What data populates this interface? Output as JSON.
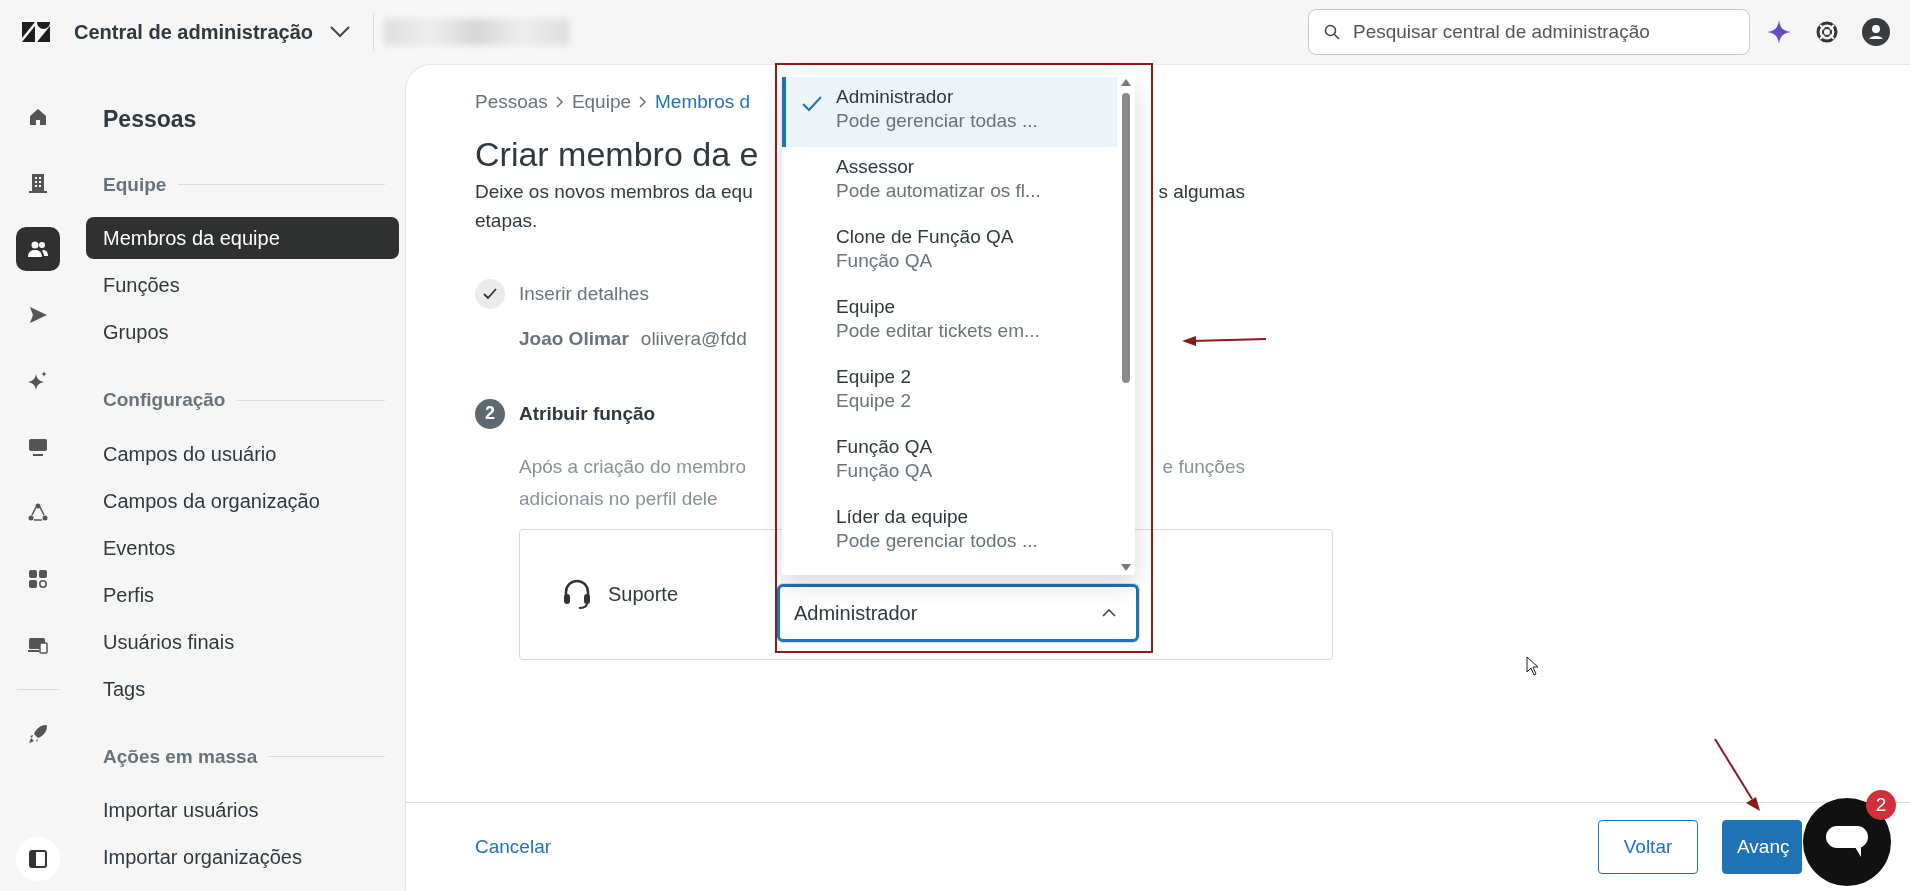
{
  "topbar": {
    "title": "Central de administração",
    "search": {
      "placeholder": "Pesquisar central de administração"
    }
  },
  "rail": [
    {
      "selected": false
    },
    {
      "selected": false
    },
    {
      "selected": true
    },
    {
      "selected": false
    },
    {
      "selected": false
    },
    {
      "selected": false
    },
    {
      "selected": false
    },
    {
      "selected": false
    },
    {
      "selected": false
    },
    {
      "selected": false
    }
  ],
  "sidebar": {
    "title": "Pessoas",
    "sections": [
      {
        "heading": "Equipe",
        "items": [
          {
            "label": "Membros da equipe",
            "selected": true
          },
          {
            "label": "Funções",
            "selected": false
          },
          {
            "label": "Grupos",
            "selected": false
          }
        ]
      },
      {
        "heading": "Configuração",
        "items": [
          {
            "label": "Campos do usuário",
            "selected": false
          },
          {
            "label": "Campos da organização",
            "selected": false
          },
          {
            "label": "Eventos",
            "selected": false
          },
          {
            "label": "Perfis",
            "selected": false
          },
          {
            "label": "Usuários finais",
            "selected": false
          },
          {
            "label": "Tags",
            "selected": false
          }
        ]
      },
      {
        "heading": "Ações em massa",
        "items": [
          {
            "label": "Importar usuários",
            "selected": false
          },
          {
            "label": "Importar organizações",
            "selected": false
          }
        ]
      }
    ]
  },
  "breadcrumb": [
    {
      "label": "Pessoas",
      "current": false
    },
    {
      "label": "Equipe",
      "current": false
    },
    {
      "label": "Membros d",
      "current": true
    }
  ],
  "page": {
    "title": "Criar membro da e",
    "description_left": "Deixe os novos membros da equ",
    "description_right": "s algumas",
    "description_line2": "etapas."
  },
  "steps": [
    {
      "kind": "done",
      "label": "Inserir detalhes",
      "name": "Joao Olimar",
      "email": "oliivera@fdd"
    },
    {
      "kind": "number",
      "number": "2",
      "label": "Atribuir função",
      "note_left": "Após a criação do membro",
      "note_right": "e funções",
      "note_line2": "adicionais no perfil dele"
    }
  ],
  "product": {
    "label": "Suporte",
    "select_value": "Administrador",
    "expanded": true
  },
  "dropdown": {
    "options": [
      {
        "label": "Administrador",
        "description": "Pode gerenciar todas ...",
        "selected": true
      },
      {
        "label": "Assessor",
        "description": "Pode automatizar os fl...",
        "selected": false
      },
      {
        "label": "Clone de Função QA",
        "description": "Função QA",
        "selected": false
      },
      {
        "label": "Equipe",
        "description": "Pode editar tickets em...",
        "selected": false
      },
      {
        "label": "Equipe 2",
        "description": "Equipe 2",
        "selected": false
      },
      {
        "label": "Função QA",
        "description": "Função QA",
        "selected": false
      },
      {
        "label": "Líder da equipe",
        "description": "Pode gerenciar todos ...",
        "selected": false
      }
    ]
  },
  "footer": {
    "cancel": "Cancelar",
    "back": "Voltar",
    "next": "Avanç"
  },
  "chat": {
    "badge": "2"
  }
}
